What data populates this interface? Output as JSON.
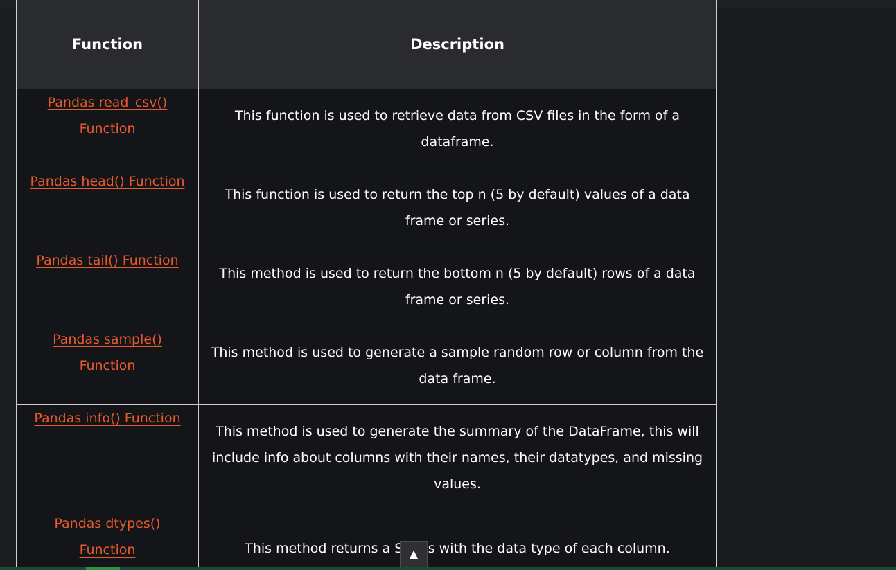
{
  "table": {
    "headers": {
      "function": "Function",
      "description": "Description"
    },
    "rows": [
      {
        "function": "Pandas read_csv() Function",
        "description": "This function is used to retrieve data from CSV files in the form of a dataframe."
      },
      {
        "function": "Pandas head() Function",
        "description": "This function is used to return the top n (5 by default) values of a data frame or series."
      },
      {
        "function": "Pandas tail() Function",
        "description": "This method is used to return the bottom n (5 by default) rows of a data frame or series."
      },
      {
        "function": "Pandas sample() Function",
        "description": "This method is used to generate a sample random row or column from the data frame."
      },
      {
        "function": "Pandas info() Function",
        "description": "This method is used to generate the summary of the DataFrame, this will include info about columns with their names, their datatypes, and missing values."
      },
      {
        "function": "Pandas dtypes() Function",
        "description": "This method returns a Series with the data type of each column."
      }
    ]
  },
  "scroll_top": {
    "label": "▲",
    "icon": "arrow-up-icon"
  },
  "colors": {
    "link": "#e8592e",
    "header_bg": "#2a2b2e",
    "cell_bg": "#141518",
    "page_bg": "#1b1c1f",
    "accent": "#2f8d46"
  }
}
